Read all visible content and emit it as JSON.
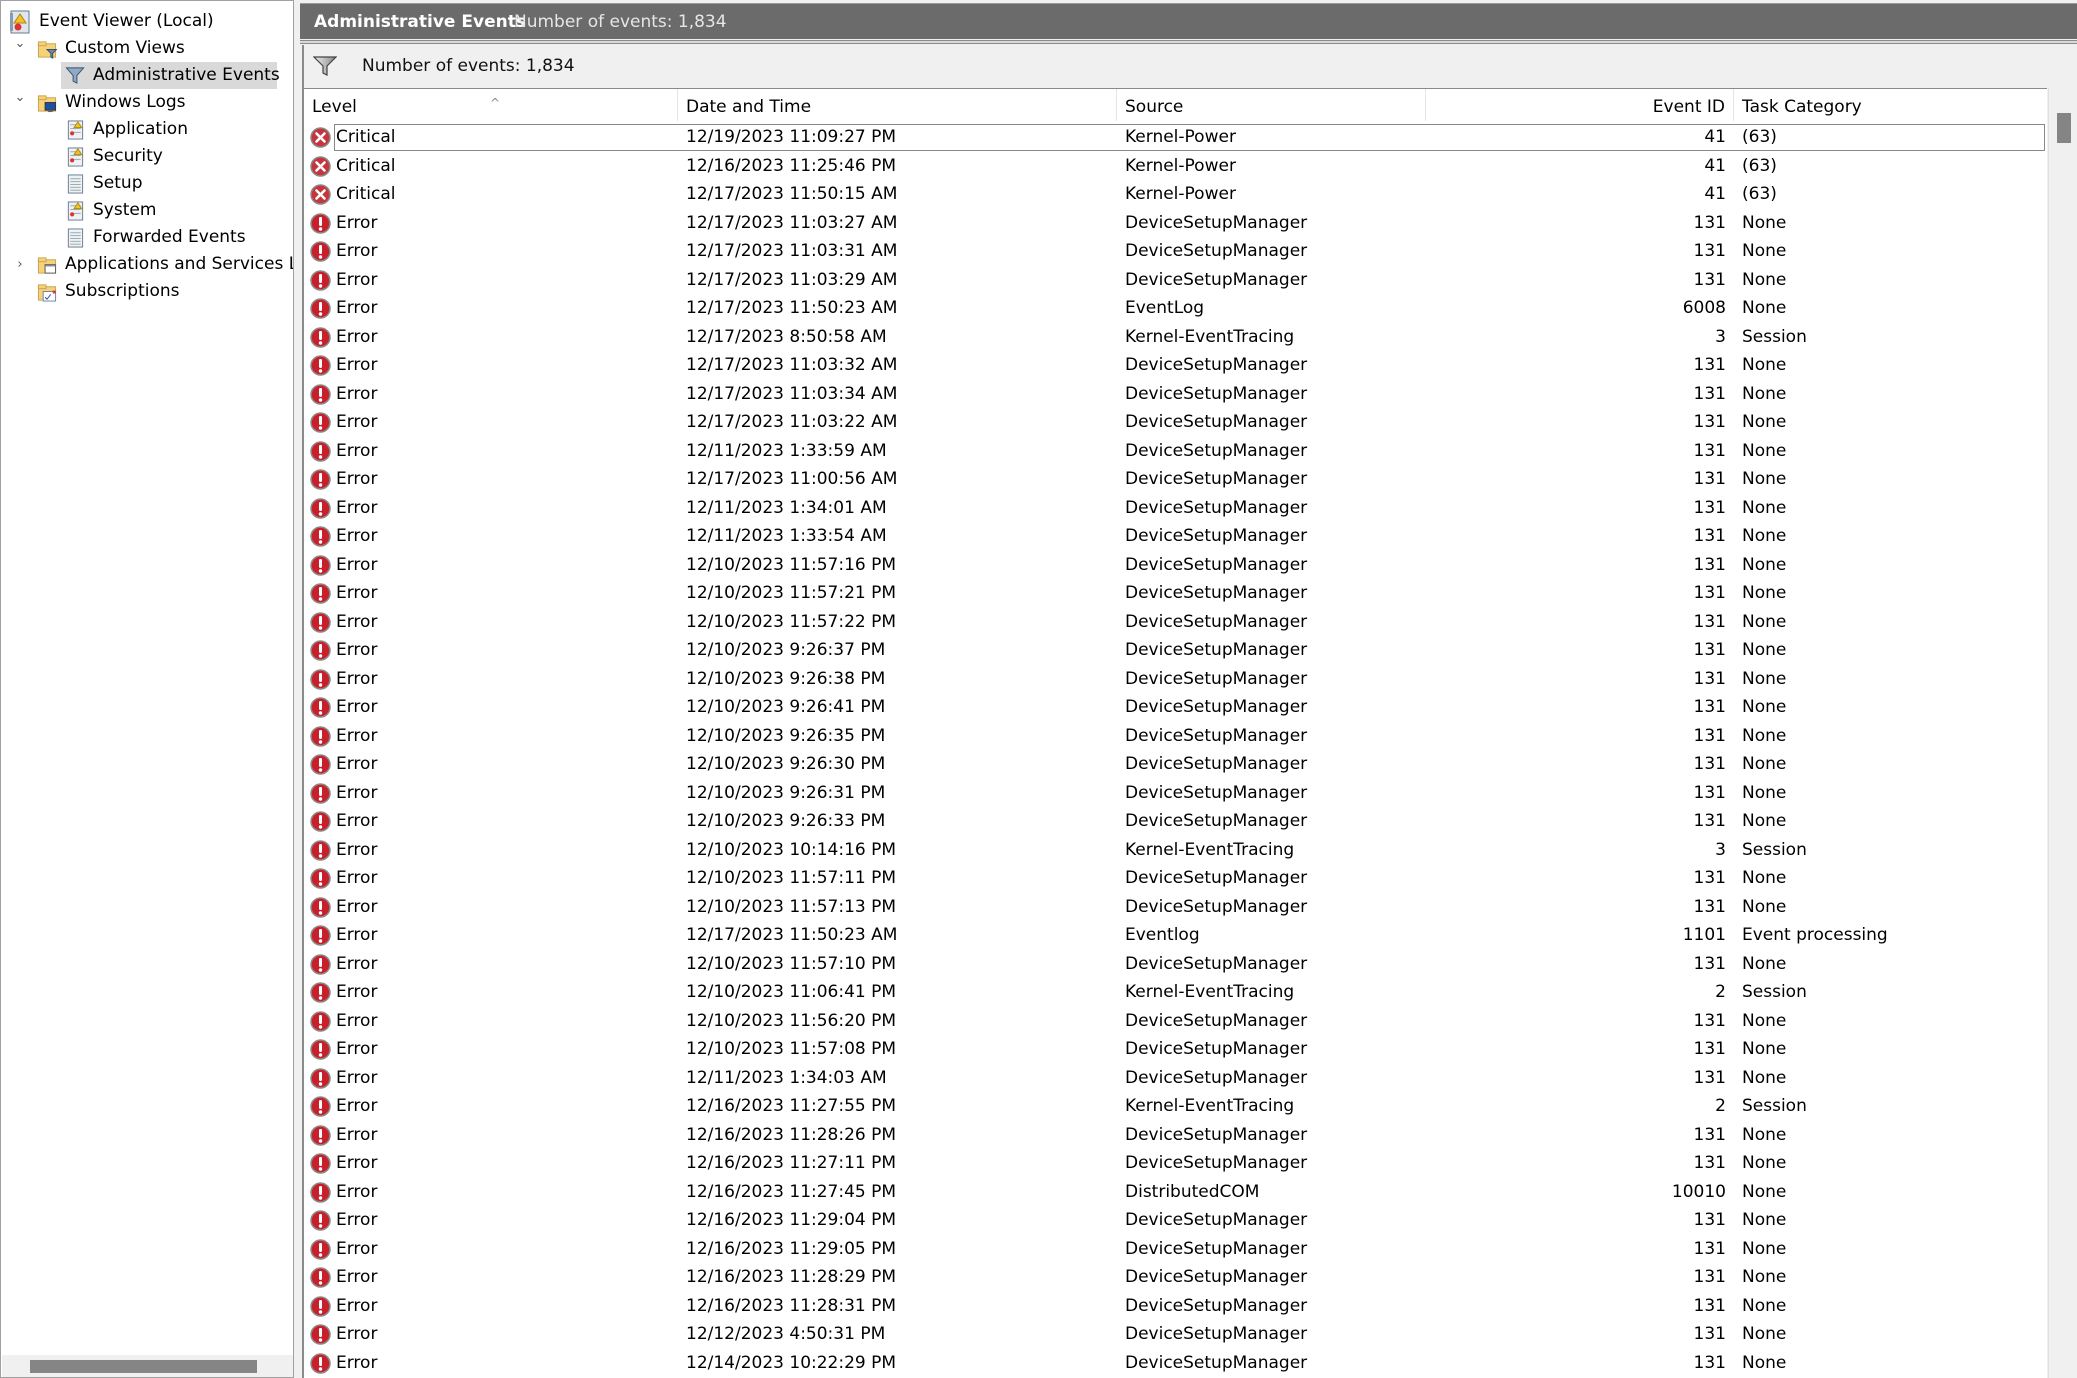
{
  "tree": {
    "root": {
      "label": "Event Viewer (Local)",
      "icon": "event-viewer-icon"
    },
    "items": [
      {
        "label": "Custom Views",
        "icon": "folder-filter-icon",
        "level": 1,
        "expander": "expanded"
      },
      {
        "label": "Administrative Events",
        "icon": "filter-icon",
        "level": 2,
        "selected": true
      },
      {
        "label": "Windows Logs",
        "icon": "folder-computer-icon",
        "level": 1,
        "expander": "expanded"
      },
      {
        "label": "Application",
        "icon": "log-warning-icon",
        "level": 2
      },
      {
        "label": "Security",
        "icon": "log-warning-icon",
        "level": 2
      },
      {
        "label": "Setup",
        "icon": "log-icon",
        "level": 2
      },
      {
        "label": "System",
        "icon": "log-warning-icon",
        "level": 2
      },
      {
        "label": "Forwarded Events",
        "icon": "log-icon",
        "level": 2
      },
      {
        "label": "Applications and Services Logs",
        "icon": "folder-window-icon",
        "level": 1,
        "expander": "collapsed"
      },
      {
        "label": "Subscriptions",
        "icon": "folder-subscription-icon",
        "level": 1
      }
    ]
  },
  "header": {
    "title": "Administrative Events",
    "count_text": "Number of events: 1,834"
  },
  "filter_bar": {
    "icon": "filter-icon",
    "text": "Number of events: 1,834"
  },
  "table": {
    "columns": [
      "Level",
      "Date and Time",
      "Source",
      "Event ID",
      "Task Category"
    ],
    "sorted_column": "Level",
    "rows": [
      {
        "level": "Critical",
        "date": "12/19/2023 11:09:27 PM",
        "source": "Kernel-Power",
        "id": "41",
        "task": "(63)"
      },
      {
        "level": "Critical",
        "date": "12/16/2023 11:25:46 PM",
        "source": "Kernel-Power",
        "id": "41",
        "task": "(63)"
      },
      {
        "level": "Critical",
        "date": "12/17/2023 11:50:15 AM",
        "source": "Kernel-Power",
        "id": "41",
        "task": "(63)"
      },
      {
        "level": "Error",
        "date": "12/17/2023 11:03:27 AM",
        "source": "DeviceSetupManager",
        "id": "131",
        "task": "None"
      },
      {
        "level": "Error",
        "date": "12/17/2023 11:03:31 AM",
        "source": "DeviceSetupManager",
        "id": "131",
        "task": "None"
      },
      {
        "level": "Error",
        "date": "12/17/2023 11:03:29 AM",
        "source": "DeviceSetupManager",
        "id": "131",
        "task": "None"
      },
      {
        "level": "Error",
        "date": "12/17/2023 11:50:23 AM",
        "source": "EventLog",
        "id": "6008",
        "task": "None"
      },
      {
        "level": "Error",
        "date": "12/17/2023 8:50:58 AM",
        "source": "Kernel-EventTracing",
        "id": "3",
        "task": "Session"
      },
      {
        "level": "Error",
        "date": "12/17/2023 11:03:32 AM",
        "source": "DeviceSetupManager",
        "id": "131",
        "task": "None"
      },
      {
        "level": "Error",
        "date": "12/17/2023 11:03:34 AM",
        "source": "DeviceSetupManager",
        "id": "131",
        "task": "None"
      },
      {
        "level": "Error",
        "date": "12/17/2023 11:03:22 AM",
        "source": "DeviceSetupManager",
        "id": "131",
        "task": "None"
      },
      {
        "level": "Error",
        "date": "12/11/2023 1:33:59 AM",
        "source": "DeviceSetupManager",
        "id": "131",
        "task": "None"
      },
      {
        "level": "Error",
        "date": "12/17/2023 11:00:56 AM",
        "source": "DeviceSetupManager",
        "id": "131",
        "task": "None"
      },
      {
        "level": "Error",
        "date": "12/11/2023 1:34:01 AM",
        "source": "DeviceSetupManager",
        "id": "131",
        "task": "None"
      },
      {
        "level": "Error",
        "date": "12/11/2023 1:33:54 AM",
        "source": "DeviceSetupManager",
        "id": "131",
        "task": "None"
      },
      {
        "level": "Error",
        "date": "12/10/2023 11:57:16 PM",
        "source": "DeviceSetupManager",
        "id": "131",
        "task": "None"
      },
      {
        "level": "Error",
        "date": "12/10/2023 11:57:21 PM",
        "source": "DeviceSetupManager",
        "id": "131",
        "task": "None"
      },
      {
        "level": "Error",
        "date": "12/10/2023 11:57:22 PM",
        "source": "DeviceSetupManager",
        "id": "131",
        "task": "None"
      },
      {
        "level": "Error",
        "date": "12/10/2023 9:26:37 PM",
        "source": "DeviceSetupManager",
        "id": "131",
        "task": "None"
      },
      {
        "level": "Error",
        "date": "12/10/2023 9:26:38 PM",
        "source": "DeviceSetupManager",
        "id": "131",
        "task": "None"
      },
      {
        "level": "Error",
        "date": "12/10/2023 9:26:41 PM",
        "source": "DeviceSetupManager",
        "id": "131",
        "task": "None"
      },
      {
        "level": "Error",
        "date": "12/10/2023 9:26:35 PM",
        "source": "DeviceSetupManager",
        "id": "131",
        "task": "None"
      },
      {
        "level": "Error",
        "date": "12/10/2023 9:26:30 PM",
        "source": "DeviceSetupManager",
        "id": "131",
        "task": "None"
      },
      {
        "level": "Error",
        "date": "12/10/2023 9:26:31 PM",
        "source": "DeviceSetupManager",
        "id": "131",
        "task": "None"
      },
      {
        "level": "Error",
        "date": "12/10/2023 9:26:33 PM",
        "source": "DeviceSetupManager",
        "id": "131",
        "task": "None"
      },
      {
        "level": "Error",
        "date": "12/10/2023 10:14:16 PM",
        "source": "Kernel-EventTracing",
        "id": "3",
        "task": "Session"
      },
      {
        "level": "Error",
        "date": "12/10/2023 11:57:11 PM",
        "source": "DeviceSetupManager",
        "id": "131",
        "task": "None"
      },
      {
        "level": "Error",
        "date": "12/10/2023 11:57:13 PM",
        "source": "DeviceSetupManager",
        "id": "131",
        "task": "None"
      },
      {
        "level": "Error",
        "date": "12/17/2023 11:50:23 AM",
        "source": "Eventlog",
        "id": "1101",
        "task": "Event processing"
      },
      {
        "level": "Error",
        "date": "12/10/2023 11:57:10 PM",
        "source": "DeviceSetupManager",
        "id": "131",
        "task": "None"
      },
      {
        "level": "Error",
        "date": "12/10/2023 11:06:41 PM",
        "source": "Kernel-EventTracing",
        "id": "2",
        "task": "Session"
      },
      {
        "level": "Error",
        "date": "12/10/2023 11:56:20 PM",
        "source": "DeviceSetupManager",
        "id": "131",
        "task": "None"
      },
      {
        "level": "Error",
        "date": "12/10/2023 11:57:08 PM",
        "source": "DeviceSetupManager",
        "id": "131",
        "task": "None"
      },
      {
        "level": "Error",
        "date": "12/11/2023 1:34:03 AM",
        "source": "DeviceSetupManager",
        "id": "131",
        "task": "None"
      },
      {
        "level": "Error",
        "date": "12/16/2023 11:27:55 PM",
        "source": "Kernel-EventTracing",
        "id": "2",
        "task": "Session"
      },
      {
        "level": "Error",
        "date": "12/16/2023 11:28:26 PM",
        "source": "DeviceSetupManager",
        "id": "131",
        "task": "None"
      },
      {
        "level": "Error",
        "date": "12/16/2023 11:27:11 PM",
        "source": "DeviceSetupManager",
        "id": "131",
        "task": "None"
      },
      {
        "level": "Error",
        "date": "12/16/2023 11:27:45 PM",
        "source": "DistributedCOM",
        "id": "10010",
        "task": "None"
      },
      {
        "level": "Error",
        "date": "12/16/2023 11:29:04 PM",
        "source": "DeviceSetupManager",
        "id": "131",
        "task": "None"
      },
      {
        "level": "Error",
        "date": "12/16/2023 11:29:05 PM",
        "source": "DeviceSetupManager",
        "id": "131",
        "task": "None"
      },
      {
        "level": "Error",
        "date": "12/16/2023 11:28:29 PM",
        "source": "DeviceSetupManager",
        "id": "131",
        "task": "None"
      },
      {
        "level": "Error",
        "date": "12/16/2023 11:28:31 PM",
        "source": "DeviceSetupManager",
        "id": "131",
        "task": "None"
      },
      {
        "level": "Error",
        "date": "12/12/2023 4:50:31 PM",
        "source": "DeviceSetupManager",
        "id": "131",
        "task": "None"
      },
      {
        "level": "Error",
        "date": "12/14/2023 10:22:29 PM",
        "source": "DeviceSetupManager",
        "id": "131",
        "task": "None"
      }
    ]
  },
  "colors": {
    "header_bar": "#6b6b6b",
    "critical": "#c8343c",
    "error": "#c8202a",
    "selection": "#d9d9d9"
  }
}
